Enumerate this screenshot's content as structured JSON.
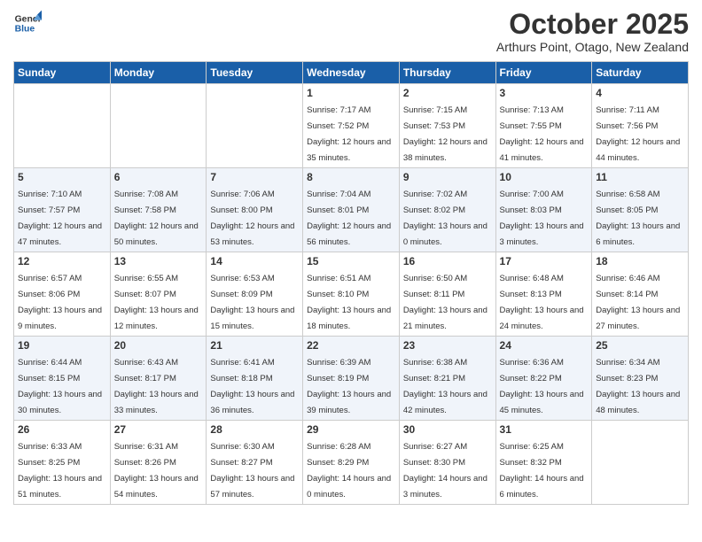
{
  "logo": {
    "general": "General",
    "blue": "Blue"
  },
  "header": {
    "month": "October 2025",
    "location": "Arthurs Point, Otago, New Zealand"
  },
  "weekdays": [
    "Sunday",
    "Monday",
    "Tuesday",
    "Wednesday",
    "Thursday",
    "Friday",
    "Saturday"
  ],
  "weeks": [
    [
      null,
      null,
      null,
      {
        "day": "1",
        "sunrise": "7:17 AM",
        "sunset": "7:52 PM",
        "daylight": "12 hours and 35 minutes."
      },
      {
        "day": "2",
        "sunrise": "7:15 AM",
        "sunset": "7:53 PM",
        "daylight": "12 hours and 38 minutes."
      },
      {
        "day": "3",
        "sunrise": "7:13 AM",
        "sunset": "7:55 PM",
        "daylight": "12 hours and 41 minutes."
      },
      {
        "day": "4",
        "sunrise": "7:11 AM",
        "sunset": "7:56 PM",
        "daylight": "12 hours and 44 minutes."
      }
    ],
    [
      {
        "day": "5",
        "sunrise": "7:10 AM",
        "sunset": "7:57 PM",
        "daylight": "12 hours and 47 minutes."
      },
      {
        "day": "6",
        "sunrise": "7:08 AM",
        "sunset": "7:58 PM",
        "daylight": "12 hours and 50 minutes."
      },
      {
        "day": "7",
        "sunrise": "7:06 AM",
        "sunset": "8:00 PM",
        "daylight": "12 hours and 53 minutes."
      },
      {
        "day": "8",
        "sunrise": "7:04 AM",
        "sunset": "8:01 PM",
        "daylight": "12 hours and 56 minutes."
      },
      {
        "day": "9",
        "sunrise": "7:02 AM",
        "sunset": "8:02 PM",
        "daylight": "13 hours and 0 minutes."
      },
      {
        "day": "10",
        "sunrise": "7:00 AM",
        "sunset": "8:03 PM",
        "daylight": "13 hours and 3 minutes."
      },
      {
        "day": "11",
        "sunrise": "6:58 AM",
        "sunset": "8:05 PM",
        "daylight": "13 hours and 6 minutes."
      }
    ],
    [
      {
        "day": "12",
        "sunrise": "6:57 AM",
        "sunset": "8:06 PM",
        "daylight": "13 hours and 9 minutes."
      },
      {
        "day": "13",
        "sunrise": "6:55 AM",
        "sunset": "8:07 PM",
        "daylight": "13 hours and 12 minutes."
      },
      {
        "day": "14",
        "sunrise": "6:53 AM",
        "sunset": "8:09 PM",
        "daylight": "13 hours and 15 minutes."
      },
      {
        "day": "15",
        "sunrise": "6:51 AM",
        "sunset": "8:10 PM",
        "daylight": "13 hours and 18 minutes."
      },
      {
        "day": "16",
        "sunrise": "6:50 AM",
        "sunset": "8:11 PM",
        "daylight": "13 hours and 21 minutes."
      },
      {
        "day": "17",
        "sunrise": "6:48 AM",
        "sunset": "8:13 PM",
        "daylight": "13 hours and 24 minutes."
      },
      {
        "day": "18",
        "sunrise": "6:46 AM",
        "sunset": "8:14 PM",
        "daylight": "13 hours and 27 minutes."
      }
    ],
    [
      {
        "day": "19",
        "sunrise": "6:44 AM",
        "sunset": "8:15 PM",
        "daylight": "13 hours and 30 minutes."
      },
      {
        "day": "20",
        "sunrise": "6:43 AM",
        "sunset": "8:17 PM",
        "daylight": "13 hours and 33 minutes."
      },
      {
        "day": "21",
        "sunrise": "6:41 AM",
        "sunset": "8:18 PM",
        "daylight": "13 hours and 36 minutes."
      },
      {
        "day": "22",
        "sunrise": "6:39 AM",
        "sunset": "8:19 PM",
        "daylight": "13 hours and 39 minutes."
      },
      {
        "day": "23",
        "sunrise": "6:38 AM",
        "sunset": "8:21 PM",
        "daylight": "13 hours and 42 minutes."
      },
      {
        "day": "24",
        "sunrise": "6:36 AM",
        "sunset": "8:22 PM",
        "daylight": "13 hours and 45 minutes."
      },
      {
        "day": "25",
        "sunrise": "6:34 AM",
        "sunset": "8:23 PM",
        "daylight": "13 hours and 48 minutes."
      }
    ],
    [
      {
        "day": "26",
        "sunrise": "6:33 AM",
        "sunset": "8:25 PM",
        "daylight": "13 hours and 51 minutes."
      },
      {
        "day": "27",
        "sunrise": "6:31 AM",
        "sunset": "8:26 PM",
        "daylight": "13 hours and 54 minutes."
      },
      {
        "day": "28",
        "sunrise": "6:30 AM",
        "sunset": "8:27 PM",
        "daylight": "13 hours and 57 minutes."
      },
      {
        "day": "29",
        "sunrise": "6:28 AM",
        "sunset": "8:29 PM",
        "daylight": "14 hours and 0 minutes."
      },
      {
        "day": "30",
        "sunrise": "6:27 AM",
        "sunset": "8:30 PM",
        "daylight": "14 hours and 3 minutes."
      },
      {
        "day": "31",
        "sunrise": "6:25 AM",
        "sunset": "8:32 PM",
        "daylight": "14 hours and 6 minutes."
      },
      null
    ]
  ]
}
